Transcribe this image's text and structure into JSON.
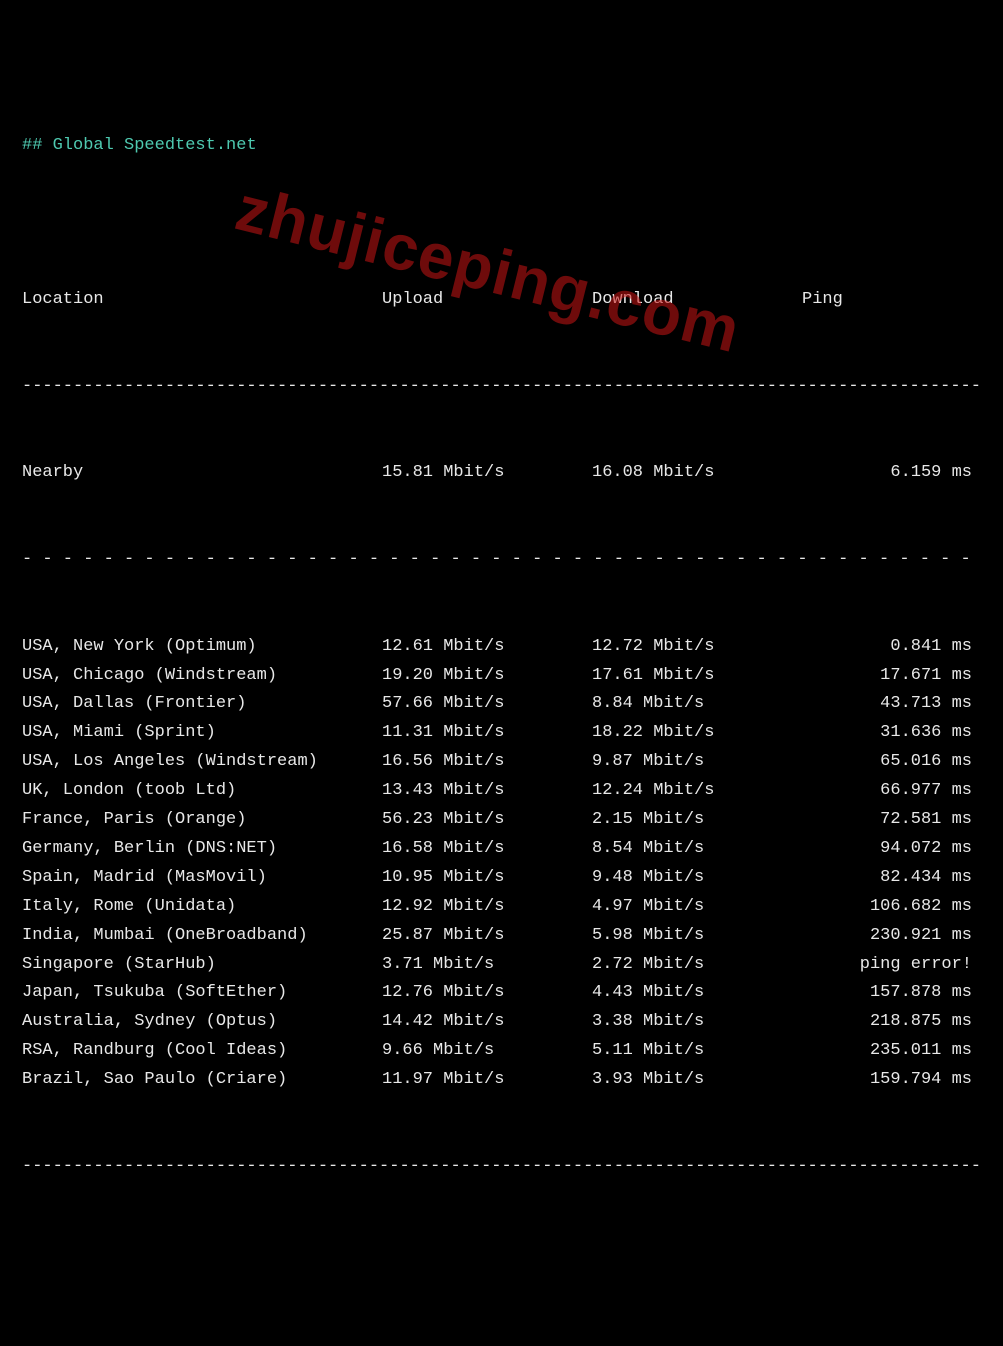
{
  "title_prefix": "## ",
  "title": "Global Speedtest.net",
  "watermark": "zhujiceping.com",
  "headers": {
    "location": "Location",
    "upload": "Upload",
    "download": "Download",
    "ping": "Ping"
  },
  "nearby": {
    "label": "Nearby",
    "upload": "15.81 Mbit/s",
    "download": "16.08 Mbit/s",
    "ping": "6.159 ms"
  },
  "rows": [
    {
      "location": "USA, New York (Optimum)",
      "upload": "12.61 Mbit/s",
      "download": "12.72 Mbit/s",
      "ping": "0.841 ms"
    },
    {
      "location": "USA, Chicago (Windstream)",
      "upload": "19.20 Mbit/s",
      "download": "17.61 Mbit/s",
      "ping": "17.671 ms"
    },
    {
      "location": "USA, Dallas (Frontier)",
      "upload": "57.66 Mbit/s",
      "download": "8.84 Mbit/s",
      "ping": "43.713 ms"
    },
    {
      "location": "USA, Miami (Sprint)",
      "upload": "11.31 Mbit/s",
      "download": "18.22 Mbit/s",
      "ping": "31.636 ms"
    },
    {
      "location": "USA, Los Angeles (Windstream)",
      "upload": "16.56 Mbit/s",
      "download": "9.87 Mbit/s",
      "ping": "65.016 ms"
    },
    {
      "location": "UK, London (toob Ltd)",
      "upload": "13.43 Mbit/s",
      "download": "12.24 Mbit/s",
      "ping": "66.977 ms"
    },
    {
      "location": "France, Paris (Orange)",
      "upload": "56.23 Mbit/s",
      "download": "2.15 Mbit/s",
      "ping": "72.581 ms"
    },
    {
      "location": "Germany, Berlin (DNS:NET)",
      "upload": "16.58 Mbit/s",
      "download": "8.54 Mbit/s",
      "ping": "94.072 ms"
    },
    {
      "location": "Spain, Madrid (MasMovil)",
      "upload": "10.95 Mbit/s",
      "download": "9.48 Mbit/s",
      "ping": "82.434 ms"
    },
    {
      "location": "Italy, Rome (Unidata)",
      "upload": "12.92 Mbit/s",
      "download": "4.97 Mbit/s",
      "ping": "106.682 ms"
    },
    {
      "location": "India, Mumbai (OneBroadband)",
      "upload": "25.87 Mbit/s",
      "download": "5.98 Mbit/s",
      "ping": "230.921 ms"
    },
    {
      "location": "Singapore (StarHub)",
      "upload": "3.71 Mbit/s",
      "download": "2.72 Mbit/s",
      "ping": "ping error!"
    },
    {
      "location": "Japan, Tsukuba (SoftEther)",
      "upload": "12.76 Mbit/s",
      "download": "4.43 Mbit/s",
      "ping": "157.878 ms"
    },
    {
      "location": "Australia, Sydney (Optus)",
      "upload": "14.42 Mbit/s",
      "download": "3.38 Mbit/s",
      "ping": "218.875 ms"
    },
    {
      "location": "RSA, Randburg (Cool Ideas)",
      "upload": "9.66 Mbit/s",
      "download": "5.11 Mbit/s",
      "ping": "235.011 ms"
    },
    {
      "location": "Brazil, Sao Paulo (Criare)",
      "upload": "11.97 Mbit/s",
      "download": "3.93 Mbit/s",
      "ping": "159.794 ms"
    }
  ],
  "chart_data": {
    "type": "table",
    "title": "Global Speedtest.net",
    "columns": [
      "Location",
      "Upload",
      "Download",
      "Ping"
    ],
    "units": [
      "",
      "Mbit/s",
      "Mbit/s",
      "ms"
    ],
    "nearby": {
      "location": "Nearby",
      "upload": 15.81,
      "download": 16.08,
      "ping": 6.159
    },
    "rows": [
      {
        "location": "USA, New York (Optimum)",
        "upload": 12.61,
        "download": 12.72,
        "ping": 0.841
      },
      {
        "location": "USA, Chicago (Windstream)",
        "upload": 19.2,
        "download": 17.61,
        "ping": 17.671
      },
      {
        "location": "USA, Dallas (Frontier)",
        "upload": 57.66,
        "download": 8.84,
        "ping": 43.713
      },
      {
        "location": "USA, Miami (Sprint)",
        "upload": 11.31,
        "download": 18.22,
        "ping": 31.636
      },
      {
        "location": "USA, Los Angeles (Windstream)",
        "upload": 16.56,
        "download": 9.87,
        "ping": 65.016
      },
      {
        "location": "UK, London (toob Ltd)",
        "upload": 13.43,
        "download": 12.24,
        "ping": 66.977
      },
      {
        "location": "France, Paris (Orange)",
        "upload": 56.23,
        "download": 2.15,
        "ping": 72.581
      },
      {
        "location": "Germany, Berlin (DNS:NET)",
        "upload": 16.58,
        "download": 8.54,
        "ping": 94.072
      },
      {
        "location": "Spain, Madrid (MasMovil)",
        "upload": 10.95,
        "download": 9.48,
        "ping": 82.434
      },
      {
        "location": "Italy, Rome (Unidata)",
        "upload": 12.92,
        "download": 4.97,
        "ping": 106.682
      },
      {
        "location": "India, Mumbai (OneBroadband)",
        "upload": 25.87,
        "download": 5.98,
        "ping": 230.921
      },
      {
        "location": "Singapore (StarHub)",
        "upload": 3.71,
        "download": 2.72,
        "ping": null,
        "ping_note": "ping error!"
      },
      {
        "location": "Japan, Tsukuba (SoftEther)",
        "upload": 12.76,
        "download": 4.43,
        "ping": 157.878
      },
      {
        "location": "Australia, Sydney (Optus)",
        "upload": 14.42,
        "download": 3.38,
        "ping": 218.875
      },
      {
        "location": "RSA, Randburg (Cool Ideas)",
        "upload": 9.66,
        "download": 5.11,
        "ping": 235.011
      },
      {
        "location": "Brazil, Sao Paulo (Criare)",
        "upload": 11.97,
        "download": 3.93,
        "ping": 159.794
      }
    ]
  }
}
